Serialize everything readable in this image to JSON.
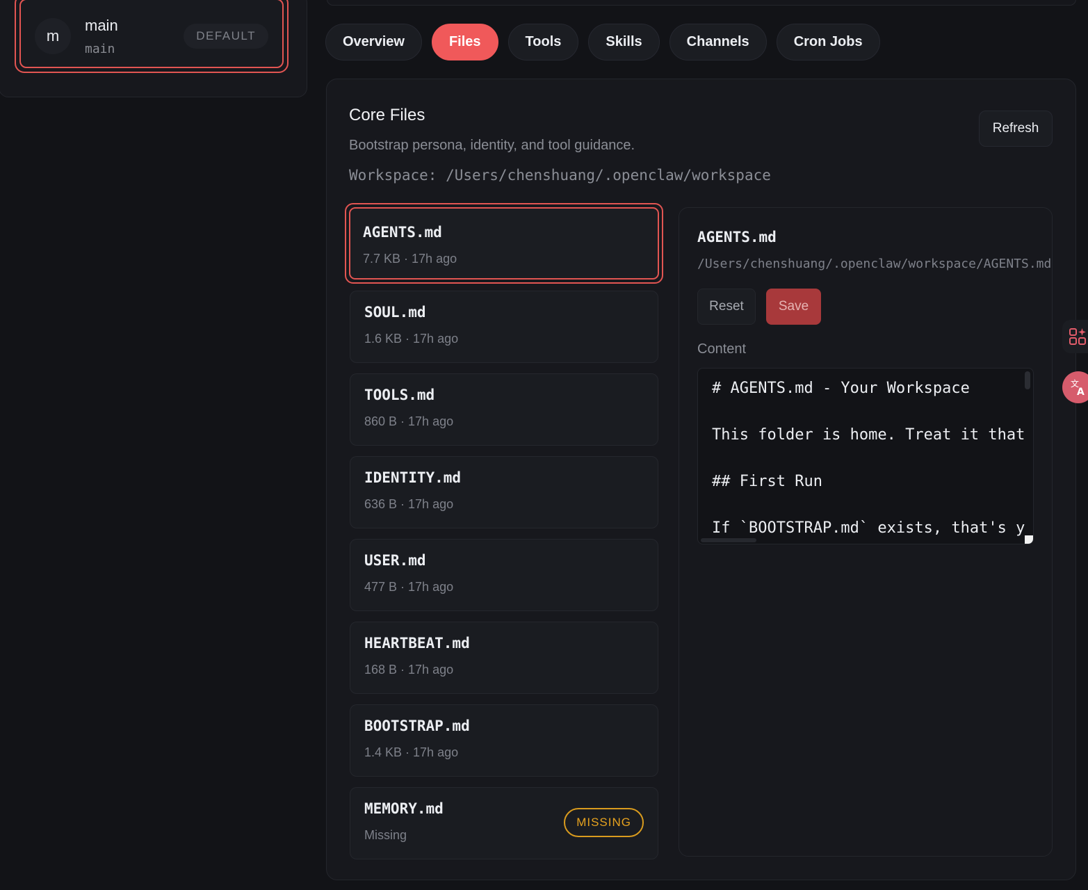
{
  "agent": {
    "avatar_letter": "m",
    "name": "main",
    "id": "main",
    "badge": "DEFAULT"
  },
  "tabs": [
    {
      "label": "Overview",
      "active": false
    },
    {
      "label": "Files",
      "active": true
    },
    {
      "label": "Tools",
      "active": false
    },
    {
      "label": "Skills",
      "active": false
    },
    {
      "label": "Channels",
      "active": false
    },
    {
      "label": "Cron Jobs",
      "active": false
    }
  ],
  "core_files": {
    "title": "Core Files",
    "subtitle": "Bootstrap persona, identity, and tool guidance.",
    "workspace": "Workspace: /Users/chenshuang/.openclaw/workspace",
    "refresh_label": "Refresh"
  },
  "files": [
    {
      "name": "AGENTS.md",
      "meta": "7.7 KB · 17h ago",
      "selected": true
    },
    {
      "name": "SOUL.md",
      "meta": "1.6 KB · 17h ago"
    },
    {
      "name": "TOOLS.md",
      "meta": "860 B · 17h ago"
    },
    {
      "name": "IDENTITY.md",
      "meta": "636 B · 17h ago"
    },
    {
      "name": "USER.md",
      "meta": "477 B · 17h ago"
    },
    {
      "name": "HEARTBEAT.md",
      "meta": "168 B · 17h ago"
    },
    {
      "name": "BOOTSTRAP.md",
      "meta": "1.4 KB · 17h ago"
    },
    {
      "name": "MEMORY.md",
      "meta": "Missing",
      "badge": "MISSING"
    }
  ],
  "editor": {
    "title": "AGENTS.md",
    "path": "/Users/chenshuang/.openclaw/workspace/AGENTS.md",
    "reset_label": "Reset",
    "save_label": "Save",
    "content_label": "Content",
    "content_lines": [
      "# AGENTS.md - Your Workspace",
      "This folder is home. Treat it that",
      "## First Run",
      "If `BOOTSTRAP.md` exists, that's y"
    ]
  },
  "colors": {
    "accent": "#f0595a",
    "save_disabled": "#a8393b",
    "missing": "#e6a21f",
    "background": "#121317"
  },
  "icons": {
    "side_apps": "apps-sparkle-icon",
    "side_translate": "translate-icon"
  }
}
